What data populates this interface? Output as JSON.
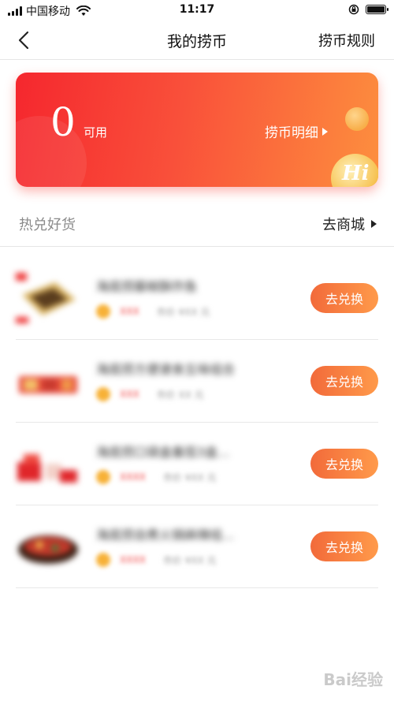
{
  "status_bar": {
    "carrier": "中国移动",
    "time": "11:17"
  },
  "nav": {
    "title": "我的捞币",
    "rules_label": "捞币规则"
  },
  "coin_card": {
    "value": "0",
    "unit_label": "可用",
    "detail_label": "捞币明细",
    "coin_glyph": "Hi"
  },
  "section": {
    "title": "热兑好货",
    "mall_label": "去商城"
  },
  "products": [
    {
      "name": "海底捞藤椒酥炸鱼",
      "price": "XXX",
      "ref": "市价 ¥XX 元",
      "button_label": "去兑换"
    },
    {
      "name": "海底捞方便速食五味组合",
      "price": "XXX",
      "ref": "市价 XX 元",
      "button_label": "去兑换"
    },
    {
      "name": "海底捞口袋盒番茄3盒...",
      "price": "XXXX",
      "ref": "市价 ¥XX 元",
      "button_label": "去兑换"
    },
    {
      "name": "海底捞自煮火锅麻辣组...",
      "price": "XXXX",
      "ref": "市价 ¥XX 元",
      "button_label": "去兑换"
    }
  ],
  "watermark": "Bai经验",
  "colors": {
    "card_start": "#f5272e",
    "card_end": "#fd8f3e",
    "button_start": "#f26a3a",
    "button_end": "#ff9a4a"
  }
}
